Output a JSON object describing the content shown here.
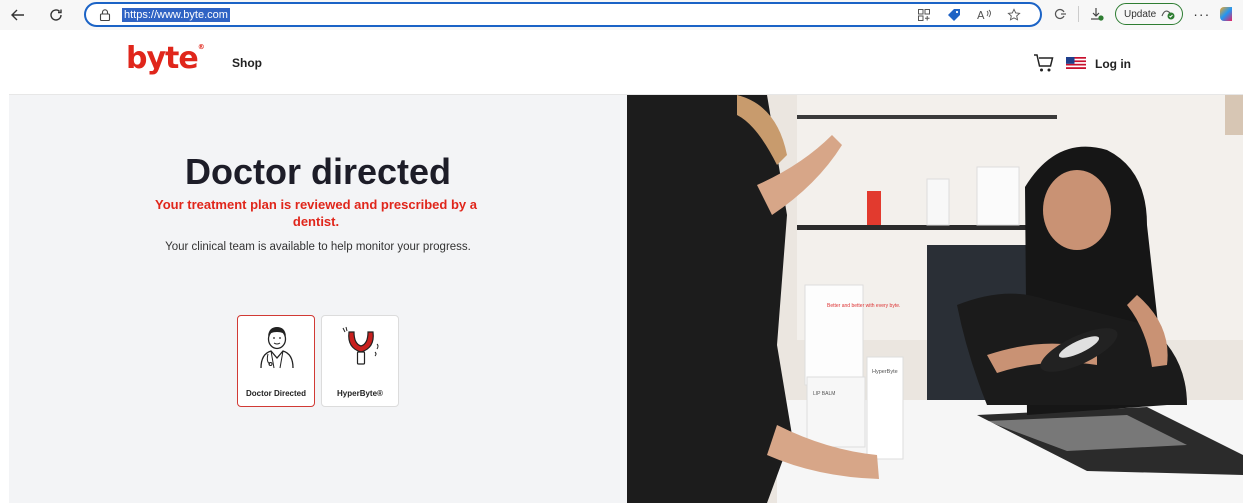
{
  "browser": {
    "url": "https://www.byte.com",
    "update_label": "Update",
    "more_label": "···"
  },
  "header": {
    "logo": "byte",
    "logo_mark": "®",
    "shop_label": "Shop",
    "login_label": "Log in"
  },
  "hero": {
    "title": "Doctor directed",
    "subtitle": "Your treatment plan is reviewed and prescribed by a dentist.",
    "description": "Your clinical team is available to help monitor your progress."
  },
  "cards": [
    {
      "label": "Doctor Directed",
      "icon": "doctor-icon",
      "selected": true
    },
    {
      "label": "HyperByte®",
      "icon": "hyperbyte-device-icon",
      "selected": false
    }
  ],
  "photo": {
    "packages": [
      "Better and better with every byte.",
      "HyperByte",
      "LIP BALM"
    ]
  },
  "colors": {
    "brand": "#e0261b",
    "selected_border": "#d13a35",
    "panel_bg": "#f3f4f6"
  }
}
